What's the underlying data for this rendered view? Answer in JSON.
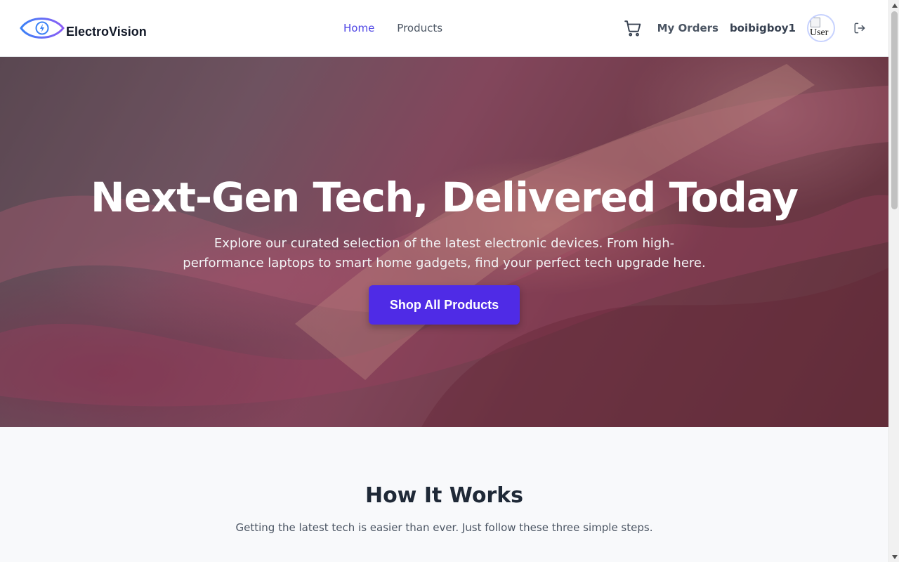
{
  "brand": {
    "name": "ElectroVision",
    "icon": "eye-bolt-logo-icon",
    "accent": "#4f46e5"
  },
  "nav": {
    "items": [
      {
        "label": "Home",
        "active": true
      },
      {
        "label": "Products",
        "active": false
      }
    ]
  },
  "user": {
    "orders_label": "My Orders",
    "username": "boibigboy1",
    "avatar_alt": "User",
    "cart_icon": "cart-icon",
    "logout_icon": "logout-icon"
  },
  "hero": {
    "title": "Next-Gen Tech, Delivered Today",
    "subtitle": "Explore our curated selection of the latest electronic devices. From high-performance laptops to smart home gadgets, find your perfect tech upgrade here.",
    "cta_label": "Shop All Products",
    "cta_color": "#4f2be6"
  },
  "how_it_works": {
    "title": "How It Works",
    "subtitle": "Getting the latest tech is easier than ever. Just follow these three simple steps."
  }
}
